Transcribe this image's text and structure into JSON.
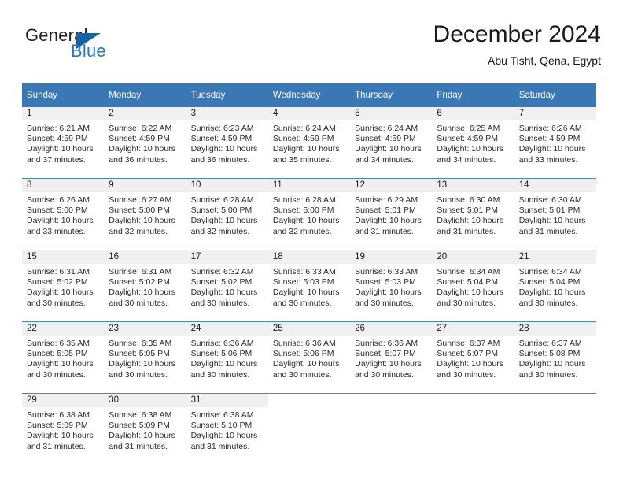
{
  "brand": {
    "word_one": "General",
    "word_two": "Blue",
    "triangle_icon": "triangle-icon",
    "primary_color": "#1464a5",
    "accent_color": "#1f7ac4"
  },
  "header": {
    "title": "December 2024",
    "location": "Abu Tisht, Qena, Egypt"
  },
  "theme": {
    "header_band": "#3a78b5",
    "row_divider": "#4a86c3",
    "daynum_band": "#f0f0f0"
  },
  "calendar": {
    "weekday_headers": [
      "Sunday",
      "Monday",
      "Tuesday",
      "Wednesday",
      "Thursday",
      "Friday",
      "Saturday"
    ],
    "weeks": [
      [
        {
          "day": "1",
          "sunrise": "Sunrise: 6:21 AM",
          "sunset": "Sunset: 4:59 PM",
          "daylight_1": "Daylight: 10 hours",
          "daylight_2": "and 37 minutes."
        },
        {
          "day": "2",
          "sunrise": "Sunrise: 6:22 AM",
          "sunset": "Sunset: 4:59 PM",
          "daylight_1": "Daylight: 10 hours",
          "daylight_2": "and 36 minutes."
        },
        {
          "day": "3",
          "sunrise": "Sunrise: 6:23 AM",
          "sunset": "Sunset: 4:59 PM",
          "daylight_1": "Daylight: 10 hours",
          "daylight_2": "and 36 minutes."
        },
        {
          "day": "4",
          "sunrise": "Sunrise: 6:24 AM",
          "sunset": "Sunset: 4:59 PM",
          "daylight_1": "Daylight: 10 hours",
          "daylight_2": "and 35 minutes."
        },
        {
          "day": "5",
          "sunrise": "Sunrise: 6:24 AM",
          "sunset": "Sunset: 4:59 PM",
          "daylight_1": "Daylight: 10 hours",
          "daylight_2": "and 34 minutes."
        },
        {
          "day": "6",
          "sunrise": "Sunrise: 6:25 AM",
          "sunset": "Sunset: 4:59 PM",
          "daylight_1": "Daylight: 10 hours",
          "daylight_2": "and 34 minutes."
        },
        {
          "day": "7",
          "sunrise": "Sunrise: 6:26 AM",
          "sunset": "Sunset: 4:59 PM",
          "daylight_1": "Daylight: 10 hours",
          "daylight_2": "and 33 minutes."
        }
      ],
      [
        {
          "day": "8",
          "sunrise": "Sunrise: 6:26 AM",
          "sunset": "Sunset: 5:00 PM",
          "daylight_1": "Daylight: 10 hours",
          "daylight_2": "and 33 minutes."
        },
        {
          "day": "9",
          "sunrise": "Sunrise: 6:27 AM",
          "sunset": "Sunset: 5:00 PM",
          "daylight_1": "Daylight: 10 hours",
          "daylight_2": "and 32 minutes."
        },
        {
          "day": "10",
          "sunrise": "Sunrise: 6:28 AM",
          "sunset": "Sunset: 5:00 PM",
          "daylight_1": "Daylight: 10 hours",
          "daylight_2": "and 32 minutes."
        },
        {
          "day": "11",
          "sunrise": "Sunrise: 6:28 AM",
          "sunset": "Sunset: 5:00 PM",
          "daylight_1": "Daylight: 10 hours",
          "daylight_2": "and 32 minutes."
        },
        {
          "day": "12",
          "sunrise": "Sunrise: 6:29 AM",
          "sunset": "Sunset: 5:01 PM",
          "daylight_1": "Daylight: 10 hours",
          "daylight_2": "and 31 minutes."
        },
        {
          "day": "13",
          "sunrise": "Sunrise: 6:30 AM",
          "sunset": "Sunset: 5:01 PM",
          "daylight_1": "Daylight: 10 hours",
          "daylight_2": "and 31 minutes."
        },
        {
          "day": "14",
          "sunrise": "Sunrise: 6:30 AM",
          "sunset": "Sunset: 5:01 PM",
          "daylight_1": "Daylight: 10 hours",
          "daylight_2": "and 31 minutes."
        }
      ],
      [
        {
          "day": "15",
          "sunrise": "Sunrise: 6:31 AM",
          "sunset": "Sunset: 5:02 PM",
          "daylight_1": "Daylight: 10 hours",
          "daylight_2": "and 30 minutes."
        },
        {
          "day": "16",
          "sunrise": "Sunrise: 6:31 AM",
          "sunset": "Sunset: 5:02 PM",
          "daylight_1": "Daylight: 10 hours",
          "daylight_2": "and 30 minutes."
        },
        {
          "day": "17",
          "sunrise": "Sunrise: 6:32 AM",
          "sunset": "Sunset: 5:02 PM",
          "daylight_1": "Daylight: 10 hours",
          "daylight_2": "and 30 minutes."
        },
        {
          "day": "18",
          "sunrise": "Sunrise: 6:33 AM",
          "sunset": "Sunset: 5:03 PM",
          "daylight_1": "Daylight: 10 hours",
          "daylight_2": "and 30 minutes."
        },
        {
          "day": "19",
          "sunrise": "Sunrise: 6:33 AM",
          "sunset": "Sunset: 5:03 PM",
          "daylight_1": "Daylight: 10 hours",
          "daylight_2": "and 30 minutes."
        },
        {
          "day": "20",
          "sunrise": "Sunrise: 6:34 AM",
          "sunset": "Sunset: 5:04 PM",
          "daylight_1": "Daylight: 10 hours",
          "daylight_2": "and 30 minutes."
        },
        {
          "day": "21",
          "sunrise": "Sunrise: 6:34 AM",
          "sunset": "Sunset: 5:04 PM",
          "daylight_1": "Daylight: 10 hours",
          "daylight_2": "and 30 minutes."
        }
      ],
      [
        {
          "day": "22",
          "sunrise": "Sunrise: 6:35 AM",
          "sunset": "Sunset: 5:05 PM",
          "daylight_1": "Daylight: 10 hours",
          "daylight_2": "and 30 minutes."
        },
        {
          "day": "23",
          "sunrise": "Sunrise: 6:35 AM",
          "sunset": "Sunset: 5:05 PM",
          "daylight_1": "Daylight: 10 hours",
          "daylight_2": "and 30 minutes."
        },
        {
          "day": "24",
          "sunrise": "Sunrise: 6:36 AM",
          "sunset": "Sunset: 5:06 PM",
          "daylight_1": "Daylight: 10 hours",
          "daylight_2": "and 30 minutes."
        },
        {
          "day": "25",
          "sunrise": "Sunrise: 6:36 AM",
          "sunset": "Sunset: 5:06 PM",
          "daylight_1": "Daylight: 10 hours",
          "daylight_2": "and 30 minutes."
        },
        {
          "day": "26",
          "sunrise": "Sunrise: 6:36 AM",
          "sunset": "Sunset: 5:07 PM",
          "daylight_1": "Daylight: 10 hours",
          "daylight_2": "and 30 minutes."
        },
        {
          "day": "27",
          "sunrise": "Sunrise: 6:37 AM",
          "sunset": "Sunset: 5:07 PM",
          "daylight_1": "Daylight: 10 hours",
          "daylight_2": "and 30 minutes."
        },
        {
          "day": "28",
          "sunrise": "Sunrise: 6:37 AM",
          "sunset": "Sunset: 5:08 PM",
          "daylight_1": "Daylight: 10 hours",
          "daylight_2": "and 30 minutes."
        }
      ],
      [
        {
          "day": "29",
          "sunrise": "Sunrise: 6:38 AM",
          "sunset": "Sunset: 5:09 PM",
          "daylight_1": "Daylight: 10 hours",
          "daylight_2": "and 31 minutes."
        },
        {
          "day": "30",
          "sunrise": "Sunrise: 6:38 AM",
          "sunset": "Sunset: 5:09 PM",
          "daylight_1": "Daylight: 10 hours",
          "daylight_2": "and 31 minutes."
        },
        {
          "day": "31",
          "sunrise": "Sunrise: 6:38 AM",
          "sunset": "Sunset: 5:10 PM",
          "daylight_1": "Daylight: 10 hours",
          "daylight_2": "and 31 minutes."
        },
        {
          "day": "",
          "sunrise": "",
          "sunset": "",
          "daylight_1": "",
          "daylight_2": ""
        },
        {
          "day": "",
          "sunrise": "",
          "sunset": "",
          "daylight_1": "",
          "daylight_2": ""
        },
        {
          "day": "",
          "sunrise": "",
          "sunset": "",
          "daylight_1": "",
          "daylight_2": ""
        },
        {
          "day": "",
          "sunrise": "",
          "sunset": "",
          "daylight_1": "",
          "daylight_2": ""
        }
      ]
    ]
  }
}
